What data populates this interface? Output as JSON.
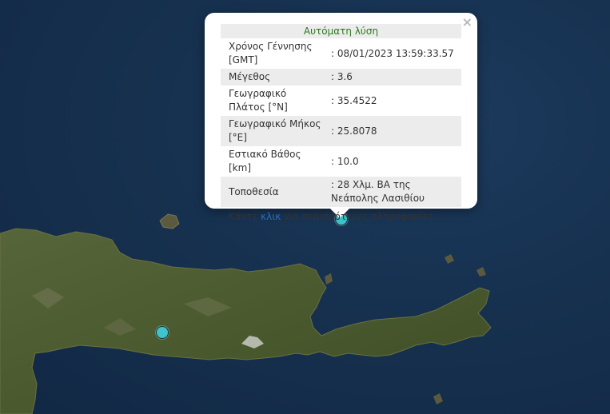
{
  "popup": {
    "title": "Αυτόματη λύση",
    "close": "×",
    "rows": [
      {
        "label": "Χρόνος Γέννησης [GMT]",
        "value": ": 08/01/2023 13:59:33.57"
      },
      {
        "label": "Μέγεθος",
        "value": ": 3.6"
      },
      {
        "label": "Γεωγραφικό Πλάτος [°N]",
        "value": ": 35.4522"
      },
      {
        "label": "Γεωγραφικό Μήκος [°E]",
        "value": ": 25.8078"
      },
      {
        "label": "Εστιακό Βάθος [km]",
        "value": ": 10.0"
      },
      {
        "label": "Τοποθεσία",
        "value": ": 28 Χλμ. ΒΑ της Νεάπολης Λασιθίου"
      }
    ],
    "more_prefix": "Κάντε ",
    "more_link": "κλικ",
    "more_suffix": " για περισσότερες πληροφορίες"
  },
  "colors": {
    "sea": "#16314f",
    "land": "#4a5a2e",
    "marker": "#3fc4cc",
    "title": "#2a7a1c",
    "link": "#2a6db5"
  }
}
